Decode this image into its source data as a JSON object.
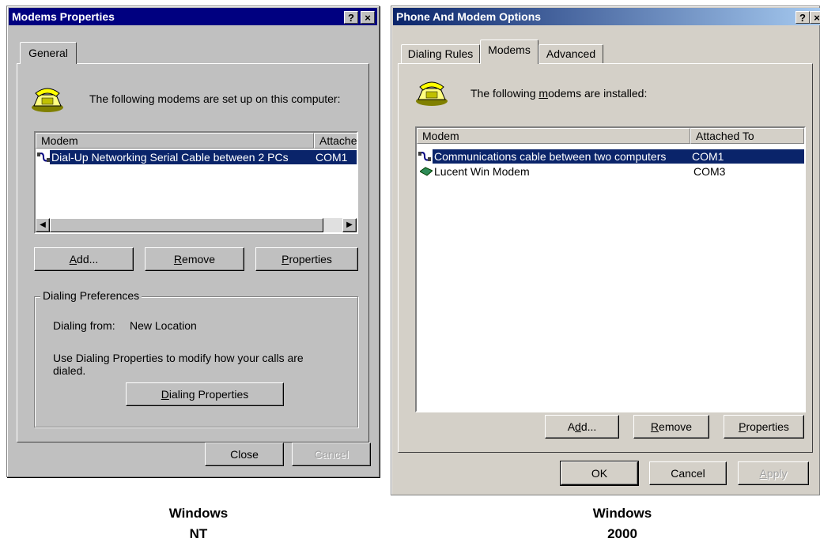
{
  "nt": {
    "title": "Modems Properties",
    "help_btn": "?",
    "close_btn": "×",
    "tab_general": "General",
    "intro": "The following modems are set up on this computer:",
    "col_modem": "Modem",
    "col_attached": "Attache",
    "rows": [
      {
        "name": "Dial-Up Networking Serial Cable between 2 PCs",
        "port": "COM1"
      }
    ],
    "add_pre": "",
    "add_u": "A",
    "add_post": "dd...",
    "remove_pre": "",
    "remove_u": "R",
    "remove_post": "emove",
    "props_pre": "",
    "props_u": "P",
    "props_post": "roperties",
    "group_title": "Dialing Preferences",
    "dialing_from_label": "Dialing from:",
    "dialing_from_value": "New Location",
    "hint": "Use Dialing Properties to modify how your calls are dialed.",
    "dialprops_pre": "",
    "dialprops_u": "D",
    "dialprops_post": "ialing Properties",
    "close": "Close",
    "cancel": "Cancel",
    "caption_line1": "Windows",
    "caption_line2": "NT"
  },
  "w2k": {
    "title": "Phone And Modem Options",
    "help_btn": "?",
    "close_btn": "×",
    "tabs": [
      "Dialing Rules",
      "Modems",
      "Advanced"
    ],
    "intro_pre": "The following ",
    "intro_u": "m",
    "intro_post": "odems are  installed:",
    "col_modem": "Modem",
    "col_attached": "Attached To",
    "rows": [
      {
        "name": "Communications cable between two computers",
        "port": "COM1"
      },
      {
        "name": "Lucent Win Modem",
        "port": "COM3"
      }
    ],
    "add_pre": "A",
    "add_u": "d",
    "add_post": "d...",
    "remove_pre": "",
    "remove_u": "R",
    "remove_post": "emove",
    "props_pre": "",
    "props_u": "P",
    "props_post": "roperties",
    "ok": "OK",
    "cancel": "Cancel",
    "apply_pre": "",
    "apply_u": "A",
    "apply_post": "pply",
    "caption_line1": "Windows",
    "caption_line2": "2000"
  }
}
